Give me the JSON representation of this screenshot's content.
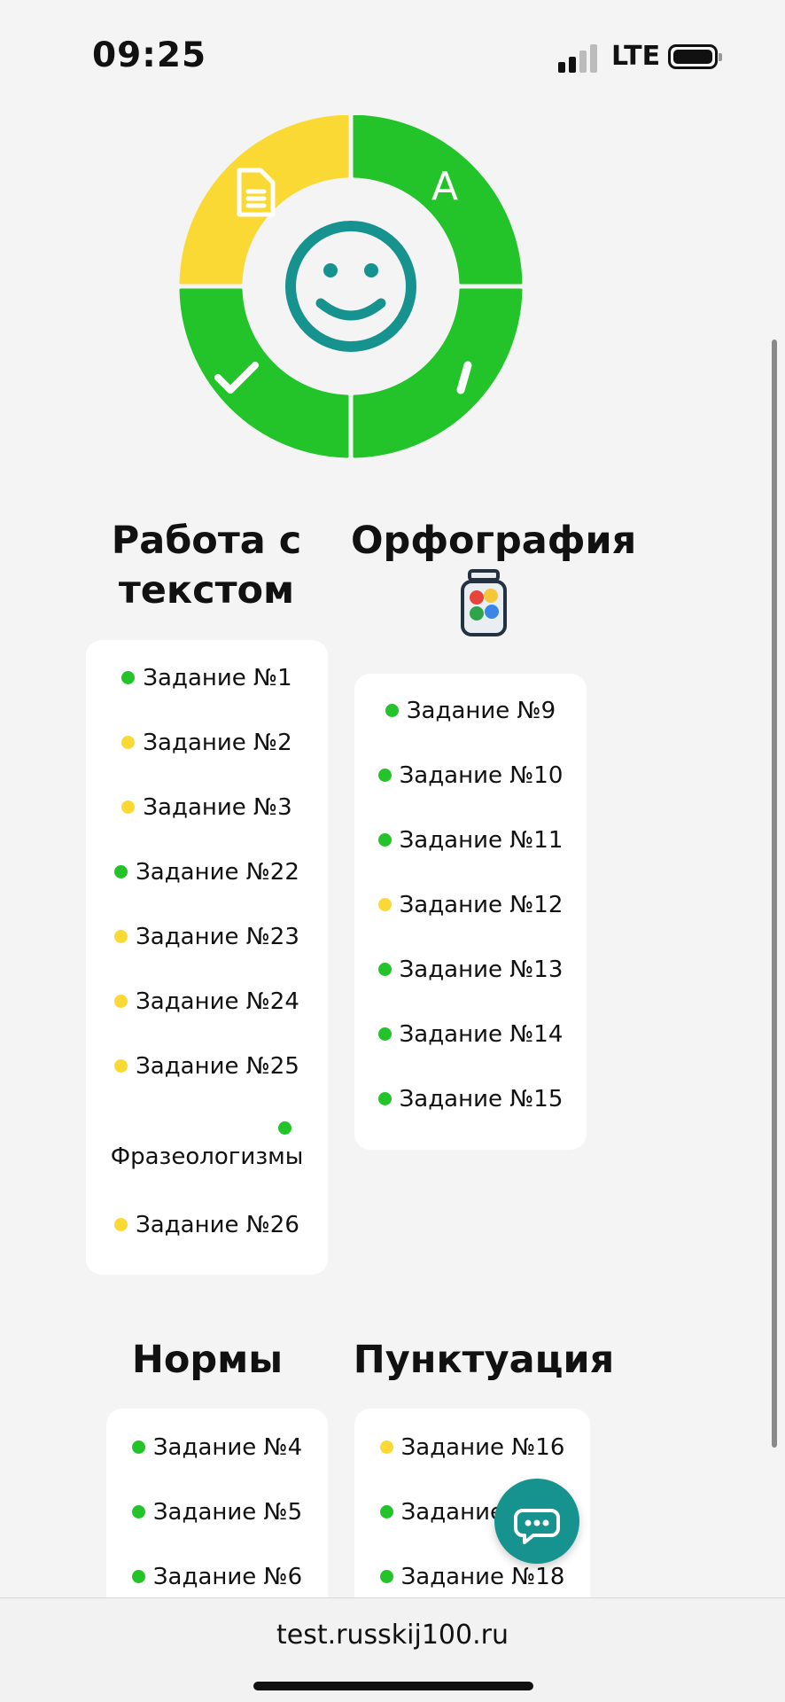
{
  "status_bar": {
    "time": "09:25",
    "network": "LTE"
  },
  "colors": {
    "done": "#22c42a",
    "partial": "#fbd935",
    "accent": "#16928f"
  },
  "wheel": {
    "center_icon": "smiley-icon",
    "segments": [
      {
        "icon": "document-icon",
        "status": "partial"
      },
      {
        "icon": "letter-a-icon",
        "status": "done"
      },
      {
        "icon": "checkmark-icon",
        "status": "done"
      },
      {
        "icon": "accent-mark-icon",
        "status": "done"
      }
    ]
  },
  "sections": {
    "text_work": {
      "title_line1": "Работа с",
      "title_line2": "текстом",
      "tasks": [
        {
          "label": "Задание №1",
          "status": "done"
        },
        {
          "label": "Задание №2",
          "status": "partial"
        },
        {
          "label": "Задание №3",
          "status": "partial"
        },
        {
          "label": "Задание №22",
          "status": "done"
        },
        {
          "label": "Задание №23",
          "status": "partial"
        },
        {
          "label": "Задание №24",
          "status": "partial"
        },
        {
          "label": "Задание №25",
          "status": "partial"
        },
        {
          "label": "Фразеологизмы",
          "status": "done"
        },
        {
          "label": "Задание №26",
          "status": "partial"
        }
      ]
    },
    "spelling": {
      "title": "Орфография",
      "icon": "jar-icon",
      "tasks": [
        {
          "label": "Задание №9",
          "status": "done"
        },
        {
          "label": "Задание №10",
          "status": "done"
        },
        {
          "label": "Задание №11",
          "status": "done"
        },
        {
          "label": "Задание №12",
          "status": "partial"
        },
        {
          "label": "Задание №13",
          "status": "done"
        },
        {
          "label": "Задание №14",
          "status": "done"
        },
        {
          "label": "Задание №15",
          "status": "done"
        }
      ]
    },
    "norms": {
      "title": "Нормы",
      "tasks": [
        {
          "label": "Задание №4",
          "status": "done"
        },
        {
          "label": "Задание №5",
          "status": "done"
        },
        {
          "label": "Задание №6",
          "status": "done"
        }
      ]
    },
    "punctuation": {
      "title": "Пунктуация",
      "tasks": [
        {
          "label": "Задание №16",
          "status": "partial"
        },
        {
          "label": "Задание №17",
          "status": "done"
        },
        {
          "label": "Задание №18",
          "status": "done"
        }
      ]
    }
  },
  "browser": {
    "url": "test.russkij100.ru"
  }
}
